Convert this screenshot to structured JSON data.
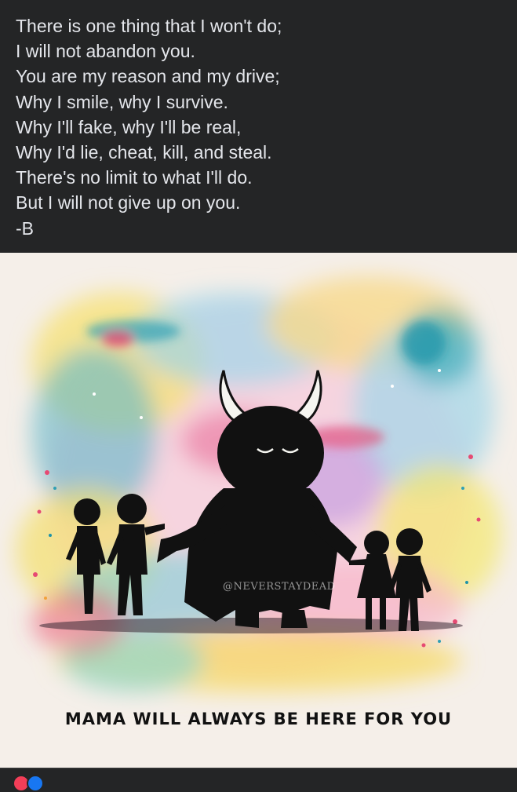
{
  "post": {
    "lines": [
      "There is one thing that I won't do;",
      "I will not abandon you.",
      "You are my reason and my drive;",
      "Why I smile, why I survive.",
      "Why I'll fake, why I'll be real,",
      "Why I'd lie, cheat, kill, and steal.",
      "There's no limit to what I'll do.",
      "But I will not give up on you.",
      "-B"
    ]
  },
  "image": {
    "caption": "MAMA WILL ALWAYS BE HERE FOR YOU",
    "watermark": "@NEVERSTAYDEAD"
  },
  "reactions": {
    "icons": [
      "like-icon",
      "love-icon"
    ]
  },
  "colors": {
    "background": "#242526",
    "text": "#e4e6eb",
    "silhouette": "#111111"
  }
}
